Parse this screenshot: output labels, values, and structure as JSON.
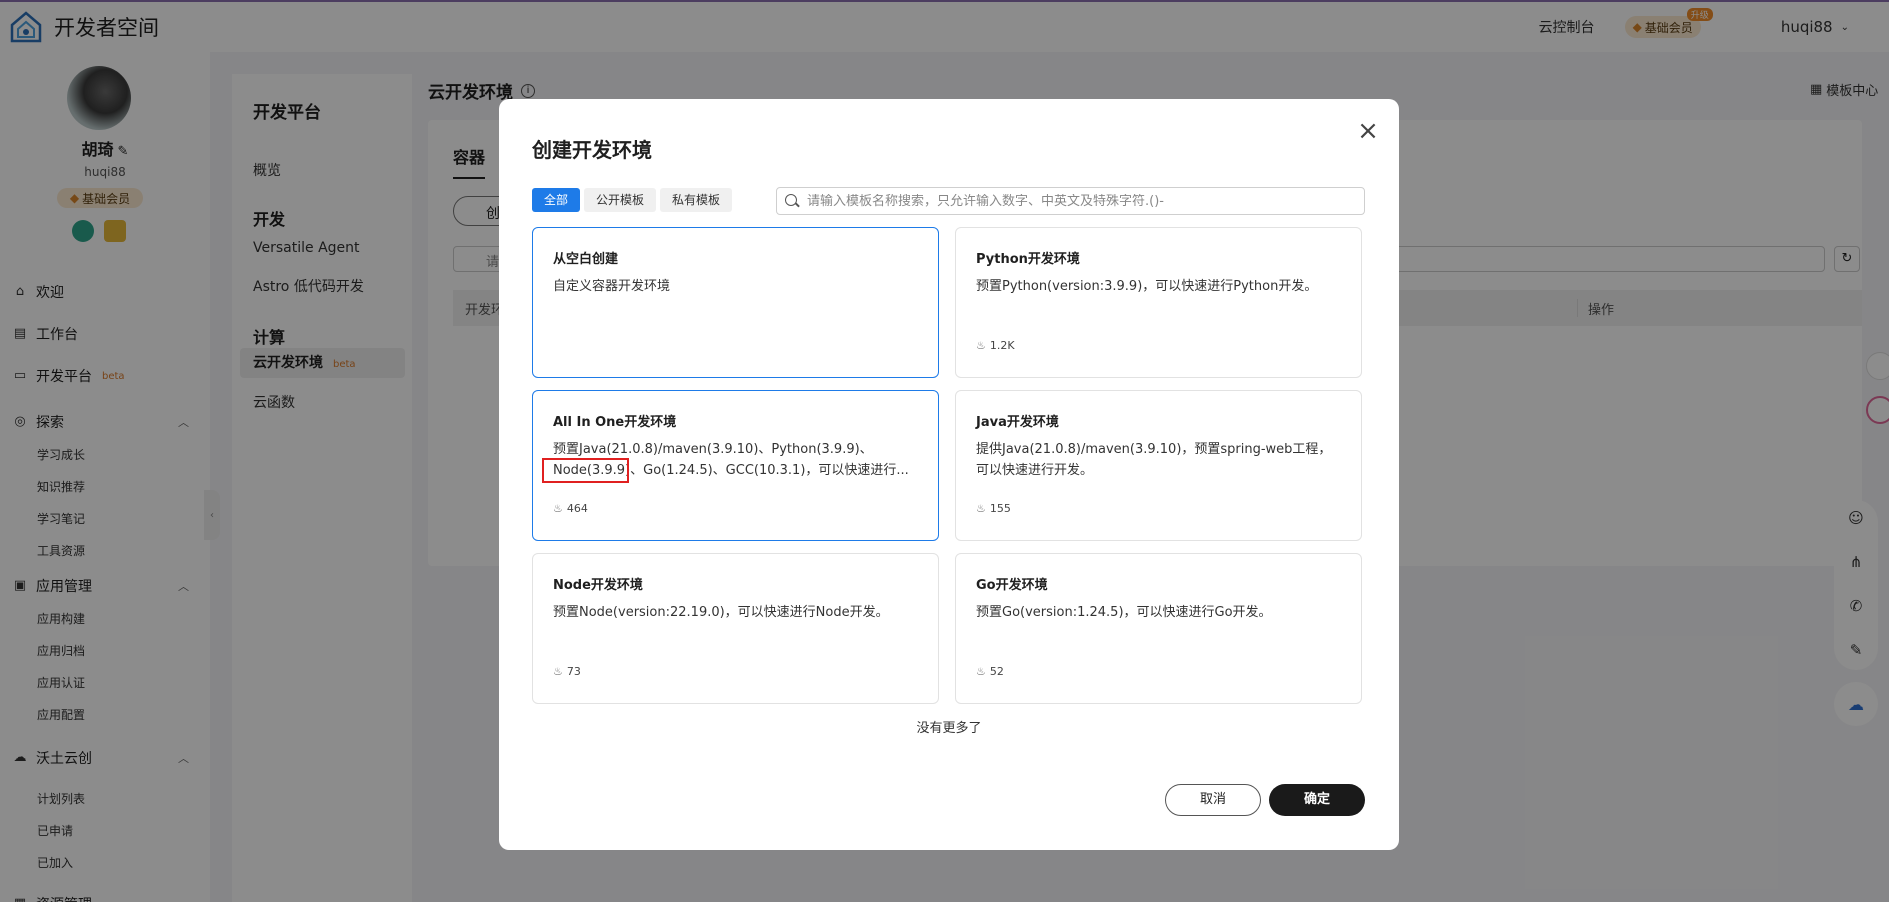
{
  "brand": {
    "name": "开发者空间"
  },
  "topbar": {
    "console": "云控制台",
    "member": "基础会员",
    "upgrade": "升级",
    "user": "huqi88"
  },
  "profile": {
    "name": "胡琦",
    "handle": "huqi88",
    "badge": "基础会员"
  },
  "sidebar": {
    "welcome": "欢迎",
    "workbench": "工作台",
    "dev_platform": "开发平台",
    "beta": "beta",
    "explore": "探索",
    "explore_items": [
      "学习成长",
      "知识推荐",
      "学习笔记",
      "工具资源"
    ],
    "app_mgmt": "应用管理",
    "app_items": [
      "应用构建",
      "应用归档",
      "应用认证",
      "应用配置"
    ],
    "wotu": "沃土云创",
    "wotu_items": [
      "计划列表",
      "已申请",
      "已加入"
    ],
    "more": "资源管理"
  },
  "panel2": {
    "title": "开发平台",
    "overview": "概览",
    "dev_head": "开发",
    "versatile": "Versatile Agent",
    "astro": "Astro 低代码开发",
    "compute_head": "计算",
    "cloud_env": "云开发环境",
    "beta": "beta",
    "cloud_fn": "云函数"
  },
  "main": {
    "title": "云开发环境",
    "template_center": "模板中心",
    "tab": "容器",
    "create_btn": "创",
    "search_placeholder": "请",
    "col_env": "开发环",
    "col_ops": "操作"
  },
  "dialog": {
    "title": "创建开发环境",
    "tabs": [
      "全部",
      "公开模板",
      "私有模板"
    ],
    "search_placeholder": "请输入模板名称搜索，只允许输入数字、中英文及特殊字符.()-",
    "cards": [
      {
        "title": "从空白创建",
        "desc": "自定义容器开发环境",
        "count": ""
      },
      {
        "title": "Python开发环境",
        "desc": "预置Python(version:3.9.9)，可以快速进行Python开发。",
        "count": "1.2K"
      },
      {
        "title": "All In One开发环境",
        "desc_line1": "预置Java(21.0.8)/maven(3.9.10)、Python(3.9.9)、",
        "desc_line2": "Node(3.9.9)、Go(1.24.5)、GCC(10.3.1)，可以快速进行...",
        "count": "464"
      },
      {
        "title": "Java开发环境",
        "desc_line1": "提供Java(21.0.8)/maven(3.9.10)，预置spring-web工程，",
        "desc_line2": "可以快速进行开发。",
        "count": "155"
      },
      {
        "title": "Node开发环境",
        "desc": "预置Node(version:22.19.0)，可以快速进行Node开发。",
        "count": "73"
      },
      {
        "title": "Go开发环境",
        "desc": "预置Go(version:1.24.5)，可以快速进行Go开发。",
        "count": "52"
      }
    ],
    "no_more": "没有更多了",
    "cancel": "取消",
    "confirm": "确定"
  },
  "colors": {
    "accent": "#1e7be8",
    "highlight": "#e02020",
    "beta": "#d97a2b"
  }
}
